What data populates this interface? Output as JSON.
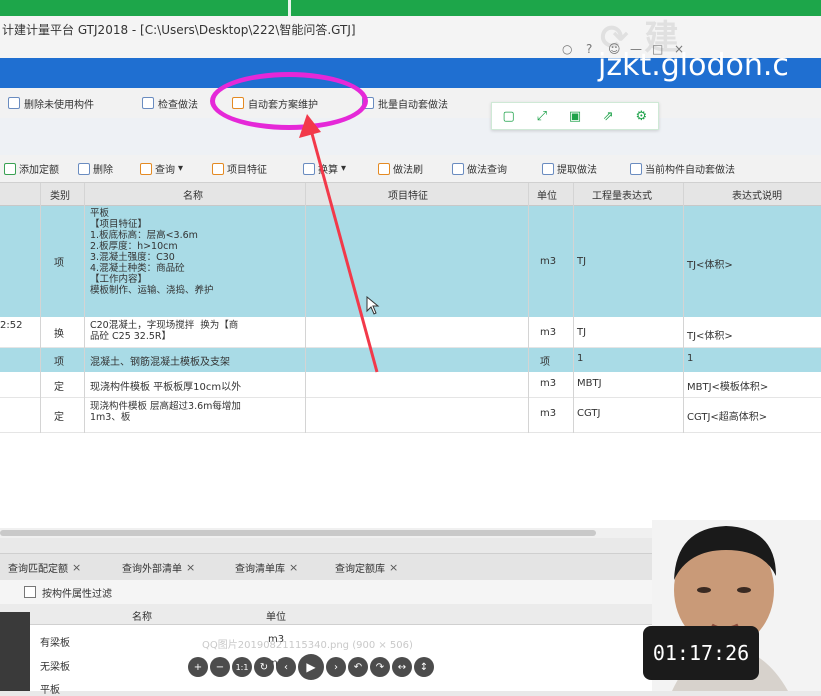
{
  "window": {
    "title": "计建计量平台 GTJ2018 - [C:\\Users\\Desktop\\222\\智能问答.GTJ]",
    "watermark": "jzkt.glodon.c",
    "window_controls": [
      "○",
      "?",
      "☺",
      "—",
      "□",
      "×"
    ]
  },
  "ribbon": {
    "items": [
      {
        "label": "删除未使用构件",
        "icon": "delete-icon"
      },
      {
        "label": "检查做法",
        "icon": "check-icon"
      },
      {
        "label": "自动套方案维护",
        "icon": "scheme-icon"
      },
      {
        "label": "批量自动套做法",
        "icon": "batch-icon"
      }
    ]
  },
  "float_toolbar": {
    "icons": [
      "copy-icon",
      "fullscreen-icon",
      "save-icon",
      "share-icon",
      "settings-icon"
    ]
  },
  "toolbar": {
    "items": [
      {
        "label": "添加定额",
        "icon": "add-icon"
      },
      {
        "label": "删除",
        "icon": "delete-icon"
      },
      {
        "label": "查询",
        "icon": "search-icon"
      },
      {
        "label": "项目特征",
        "icon": "feature-icon"
      },
      {
        "label": "换算",
        "icon": "convert-icon"
      },
      {
        "label": "做法刷",
        "icon": "brush-icon"
      },
      {
        "label": "做法查询",
        "icon": "query-icon"
      },
      {
        "label": "提取做法",
        "icon": "extract-icon"
      },
      {
        "label": "当前构件自动套做法",
        "icon": "auto-icon"
      }
    ]
  },
  "table": {
    "headers": [
      "类别",
      "名称",
      "项目特征",
      "单位",
      "工程量表达式",
      "表达式说明"
    ],
    "rows": [
      {
        "code": "",
        "category": "项",
        "name_lines": [
          "平板",
          "【项目特征】",
          "1.板底标高：层高<3.6m",
          "2.板厚度：h>10cm",
          "3.混凝土强度：C30",
          "4.混凝土种类：商品砼",
          "【工作内容】",
          "模板制作、运输、浇捣、养护"
        ],
        "unit": "m3",
        "expr": "TJ",
        "desc": "TJ<体积>"
      },
      {
        "code": "2:52",
        "category": "换",
        "name_lines": [
          "C20混凝土，字现场搅拌  换为【商",
          "品砼 C25 32.5R】"
        ],
        "unit": "m3",
        "expr": "TJ",
        "desc": "TJ<体积>"
      },
      {
        "code": "",
        "category": "项",
        "name_lines": [
          "混凝土、钢筋混凝土模板及支架"
        ],
        "unit": "项",
        "expr": "1",
        "desc": "1"
      },
      {
        "code": "",
        "category": "定",
        "name_lines": [
          "现浇构件模板 平板板厚10cm以外"
        ],
        "unit": "m3",
        "expr": "MBTJ",
        "desc": "MBTJ<模板体积>"
      },
      {
        "code": "",
        "category": "定",
        "name_lines": [
          "现浇构件模板 层高超过3.6m每增加",
          "1m3、板"
        ],
        "unit": "m3",
        "expr": "CGTJ",
        "desc": "CGTJ<超高体积>"
      }
    ]
  },
  "bottom_tabs": {
    "items": [
      "查询匹配定额",
      "查询外部清单",
      "查询清单库",
      "查询定额库"
    ],
    "filter_label": "按构件属性过滤"
  },
  "lower_table": {
    "headers": [
      "名称",
      "单位"
    ],
    "rows": [
      {
        "name": "有梁板",
        "unit": "m3"
      },
      {
        "name": "无梁板",
        "unit": "m3"
      },
      {
        "name": "平板",
        "unit": ""
      }
    ]
  },
  "player": {
    "caption": "QQ图片20190821115340.png (900 × 506)",
    "buttons": [
      "+",
      "−",
      "1:1",
      "↻",
      "‹",
      "▶",
      "›",
      "↶",
      "↷",
      "↔",
      "↕"
    ],
    "timer": "01:17:26"
  },
  "colors": {
    "top_green": "#1da64a",
    "ribbon_blue": "#1f6fd1",
    "selected_row": "#a9dbe6",
    "highlight_ellipse": "#e528d8",
    "arrow": "#f2394a"
  }
}
